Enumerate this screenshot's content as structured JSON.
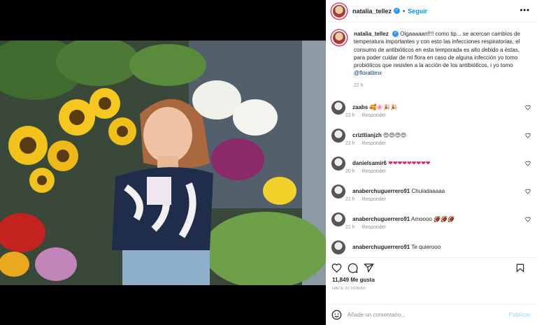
{
  "post": {
    "username": "natalia_tellez",
    "follow_label": "Seguir",
    "more_label": "•••",
    "separator": "•"
  },
  "caption": {
    "username": "natalia_tellez",
    "text": "Oigaaaaan!!!! como tip... se acercan cambios de temperatura importantes y con esto las infecciones respiratorias, el consumo de antibióticos en esta temporada es alto debido a éstas, para poder cuidar de mi flora en caso de alguna infección yo tomo probióticos que resisten a la acción de los antibióticos, i yo tomo ",
    "mention": "@floratilmx",
    "time": "22 h"
  },
  "comments": [
    {
      "username": "zaabs",
      "text": "🥰🌸🎉🎉",
      "time": "22 h",
      "reply": "Responder"
    },
    {
      "username": "crizttianjzh",
      "text": "😍😍😍😍",
      "time": "22 h",
      "reply": "Responder"
    },
    {
      "username": "danielsamir6",
      "text": "❤❤❤❤❤❤❤❤❤",
      "time": "20 h",
      "reply": "Responder"
    },
    {
      "username": "anaberchuguerrero91",
      "text": "Chuladaaaaa",
      "time": "21 h",
      "reply": "Responder"
    },
    {
      "username": "anaberchuguerrero91",
      "text": "Amoooo 🏈🏈🏈",
      "time": "21 h",
      "reply": "Responder"
    },
    {
      "username": "anaberchuguerrero91",
      "text": "Te quierooo",
      "time": "",
      "reply": ""
    }
  ],
  "actions": {
    "likes": "11,849 Me gusta",
    "date": "HACE 22 HORAS"
  },
  "composer": {
    "placeholder": "Añade un comentario...",
    "publish_label": "Publicar"
  },
  "colors": {
    "link": "#0095f6",
    "verified": "#3897f0",
    "muted": "#8e8e8e"
  },
  "icons": [
    "heart-icon",
    "comment-icon",
    "share-icon",
    "bookmark-icon",
    "emoji-icon",
    "verified-icon",
    "more-icon"
  ]
}
